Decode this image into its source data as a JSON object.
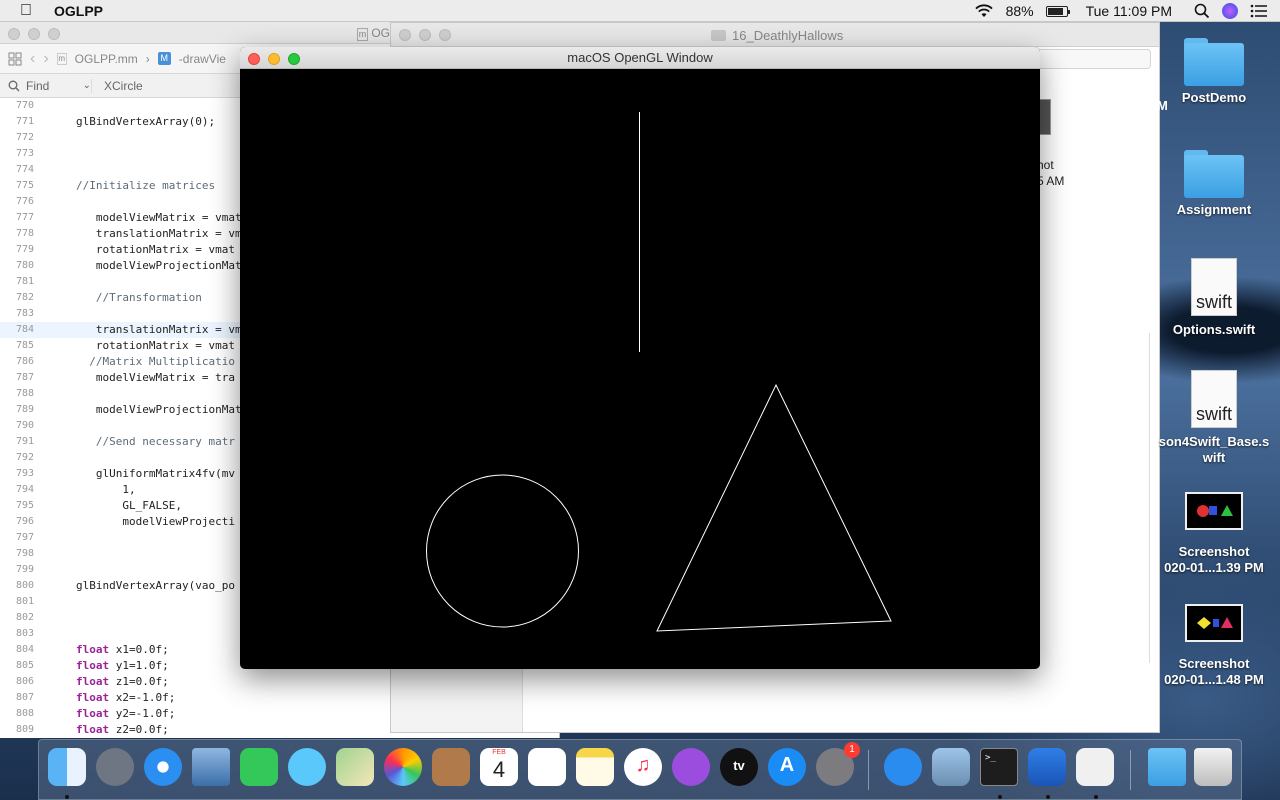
{
  "menubar": {
    "app_name": "OGLPP",
    "battery_percent": "88%",
    "battery_level": 0.88,
    "clock": "Tue 11:09 PM"
  },
  "xcode": {
    "tab_title": "OG",
    "breadcrumb_file": "OGLPP.mm",
    "breadcrumb_method": "-drawVie",
    "find_label": "Find",
    "find_value": "XCircle",
    "code_lines": [
      {
        "n": "770",
        "t": ""
      },
      {
        "n": "771",
        "t": "glBindVertexArray(0);"
      },
      {
        "n": "772",
        "t": ""
      },
      {
        "n": "773",
        "t": ""
      },
      {
        "n": "774",
        "t": ""
      },
      {
        "n": "775",
        "t": "//Initialize matrices"
      },
      {
        "n": "776",
        "t": ""
      },
      {
        "n": "777",
        "t": "   modelViewMatrix = vmat"
      },
      {
        "n": "778",
        "t": "   translationMatrix = vm"
      },
      {
        "n": "779",
        "t": "   rotationMatrix = vmat"
      },
      {
        "n": "780",
        "t": "   modelViewProjectionMat"
      },
      {
        "n": "781",
        "t": ""
      },
      {
        "n": "782",
        "t": "   //Transformation"
      },
      {
        "n": "783",
        "t": ""
      },
      {
        "n": "784",
        "t": "   translationMatrix = vm"
      },
      {
        "n": "785",
        "t": "   rotationMatrix = vmat"
      },
      {
        "n": "786",
        "t": "  //Matrix Multiplicatio"
      },
      {
        "n": "787",
        "t": "   modelViewMatrix = tra"
      },
      {
        "n": "788",
        "t": ""
      },
      {
        "n": "789",
        "t": "   modelViewProjectionMat"
      },
      {
        "n": "790",
        "t": ""
      },
      {
        "n": "791",
        "t": "   //Send necessary matr"
      },
      {
        "n": "792",
        "t": ""
      },
      {
        "n": "793",
        "t": "   glUniformMatrix4fv(mv"
      },
      {
        "n": "794",
        "t": "       1,"
      },
      {
        "n": "795",
        "t": "       GL_FALSE,"
      },
      {
        "n": "796",
        "t": "       modelViewProjecti"
      },
      {
        "n": "797",
        "t": ""
      },
      {
        "n": "798",
        "t": ""
      },
      {
        "n": "799",
        "t": ""
      },
      {
        "n": "800",
        "t": "glBindVertexArray(vao_po"
      },
      {
        "n": "801",
        "t": ""
      },
      {
        "n": "802",
        "t": ""
      },
      {
        "n": "803",
        "t": ""
      },
      {
        "n": "804",
        "t": "float x1=0.0f;"
      },
      {
        "n": "805",
        "t": "float y1=1.0f;"
      },
      {
        "n": "806",
        "t": "float z1=0.0f;"
      },
      {
        "n": "807",
        "t": "float x2=-1.0f;"
      },
      {
        "n": "808",
        "t": "float y2=-1.0f;"
      },
      {
        "n": "809",
        "t": "float z2=0.0f;"
      }
    ],
    "current_line": "784"
  },
  "finder": {
    "title": "16_DeathlyHallows",
    "item_label_line1": "hot",
    "item_label_line2": "5 AM",
    "side_fragment": "M"
  },
  "gl_window": {
    "title": "macOS OpenGL Window"
  },
  "desktop": {
    "items": [
      {
        "label": "PostDemo",
        "kind": "folder"
      },
      {
        "label": "Assignment",
        "kind": "folder"
      },
      {
        "label": "Options.swift",
        "kind": "swift-file",
        "ext": "swift"
      },
      {
        "label": "son4Swift_Base.s",
        "label2": "wift",
        "kind": "swift-file",
        "ext": "swift"
      },
      {
        "label": "Screenshot",
        "label2": "020-01...1.39 PM",
        "kind": "screenshot"
      },
      {
        "label": "Screenshot",
        "label2": "020-01...1.48 PM",
        "kind": "screenshot"
      }
    ]
  },
  "dock": {
    "calendar_month": "FEB",
    "calendar_day": "4",
    "tv_label": "tv",
    "system_prefs_badge": "1",
    "terminal_prompt": ">_"
  },
  "colors": {
    "gl_background": "#000000",
    "gl_stroke": "#ffffff",
    "folder_blue": "#4fb0ec"
  }
}
